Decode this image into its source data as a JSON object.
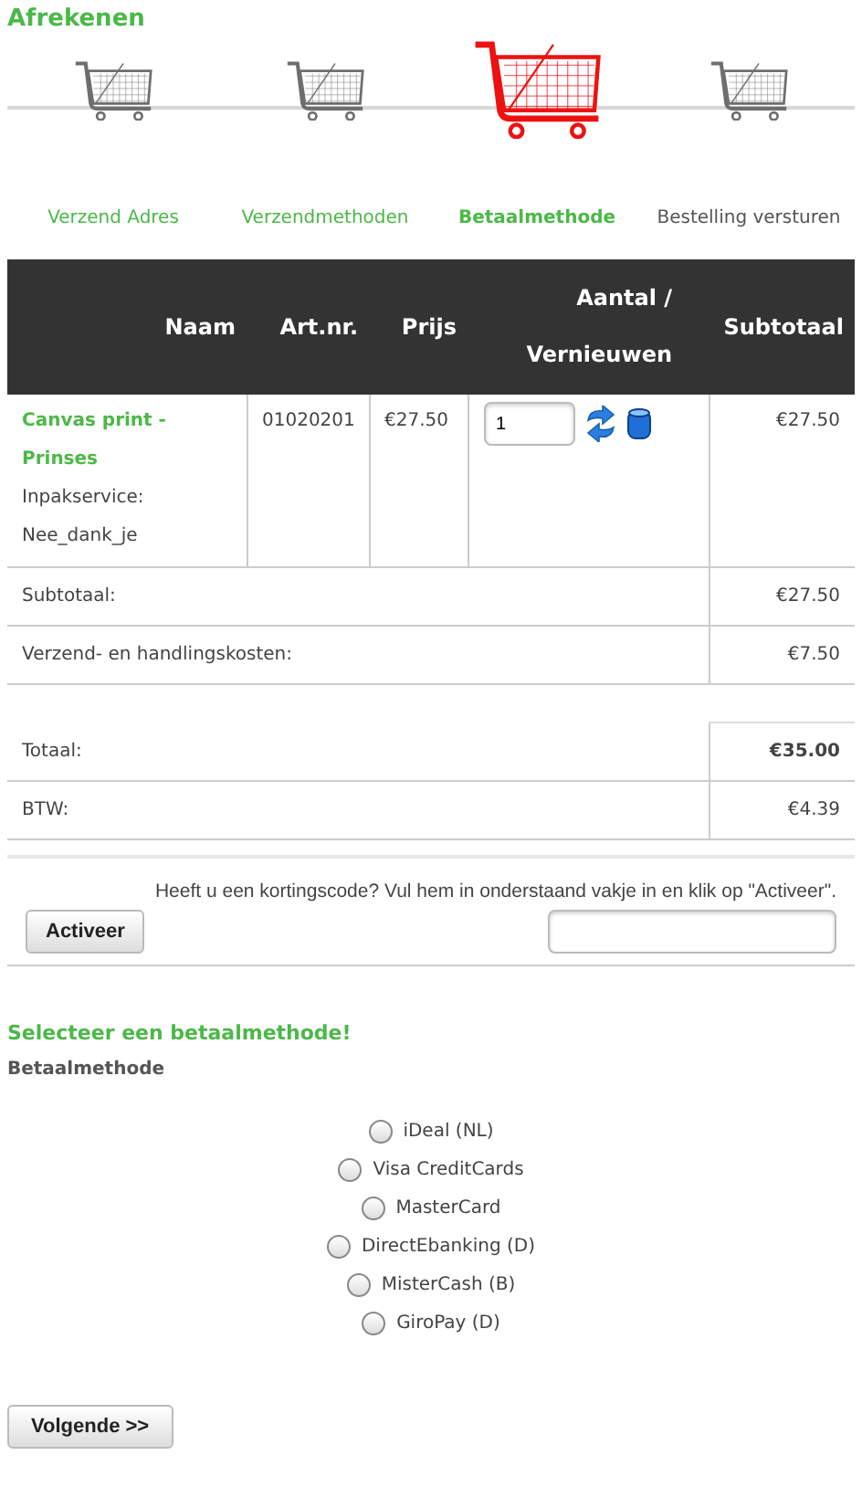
{
  "title": "Afrekenen",
  "steps": [
    {
      "label": "Verzend Adres",
      "selected": false,
      "done": true
    },
    {
      "label": "Verzendmethoden",
      "selected": false,
      "done": true
    },
    {
      "label": "Betaalmethode",
      "selected": true,
      "done": true
    },
    {
      "label": "Bestelling versturen",
      "selected": false,
      "done": false
    }
  ],
  "table": {
    "columns": [
      "Naam",
      "Art.nr.",
      "Prijs",
      "Aantal / Vernieuwen",
      "Subtotaal"
    ],
    "rows": [
      {
        "product": "Canvas print - Prinses",
        "options": [
          "Inpakservice:",
          "Nee_dank_je"
        ],
        "art_nr": "01020201",
        "price": "€27.50",
        "quantity": "1",
        "subtotal": "€27.50"
      }
    ]
  },
  "costs": [
    {
      "label": "Subtotaal:",
      "value": "€27.50",
      "bold": false
    },
    {
      "label": "Verzend- en handlingskosten:",
      "value": "€7.50",
      "bold": false
    }
  ],
  "totals": [
    {
      "label": "Totaal:",
      "value": "€35.00",
      "bold": true
    },
    {
      "label": "BTW:",
      "value": "€4.39",
      "bold": false
    }
  ],
  "coupon": {
    "text": "Heeft u een kortingscode? Vul hem in onderstaand vakje in en klik op \"Activeer\".",
    "button": "Activeer"
  },
  "payment": {
    "heading": "Selecteer een betaalmethode!",
    "label": "Betaalmethode",
    "options": [
      {
        "label": "iDeal (NL)",
        "selected": false
      },
      {
        "label": "Visa CreditCards",
        "selected": false
      },
      {
        "label": "MasterCard",
        "selected": false
      },
      {
        "label": "DirectEbanking (D)",
        "selected": false
      },
      {
        "label": "MisterCash (B)",
        "selected": false
      },
      {
        "label": "GiroPay (D)",
        "selected": false
      }
    ]
  },
  "next_button": "Volgende >>"
}
